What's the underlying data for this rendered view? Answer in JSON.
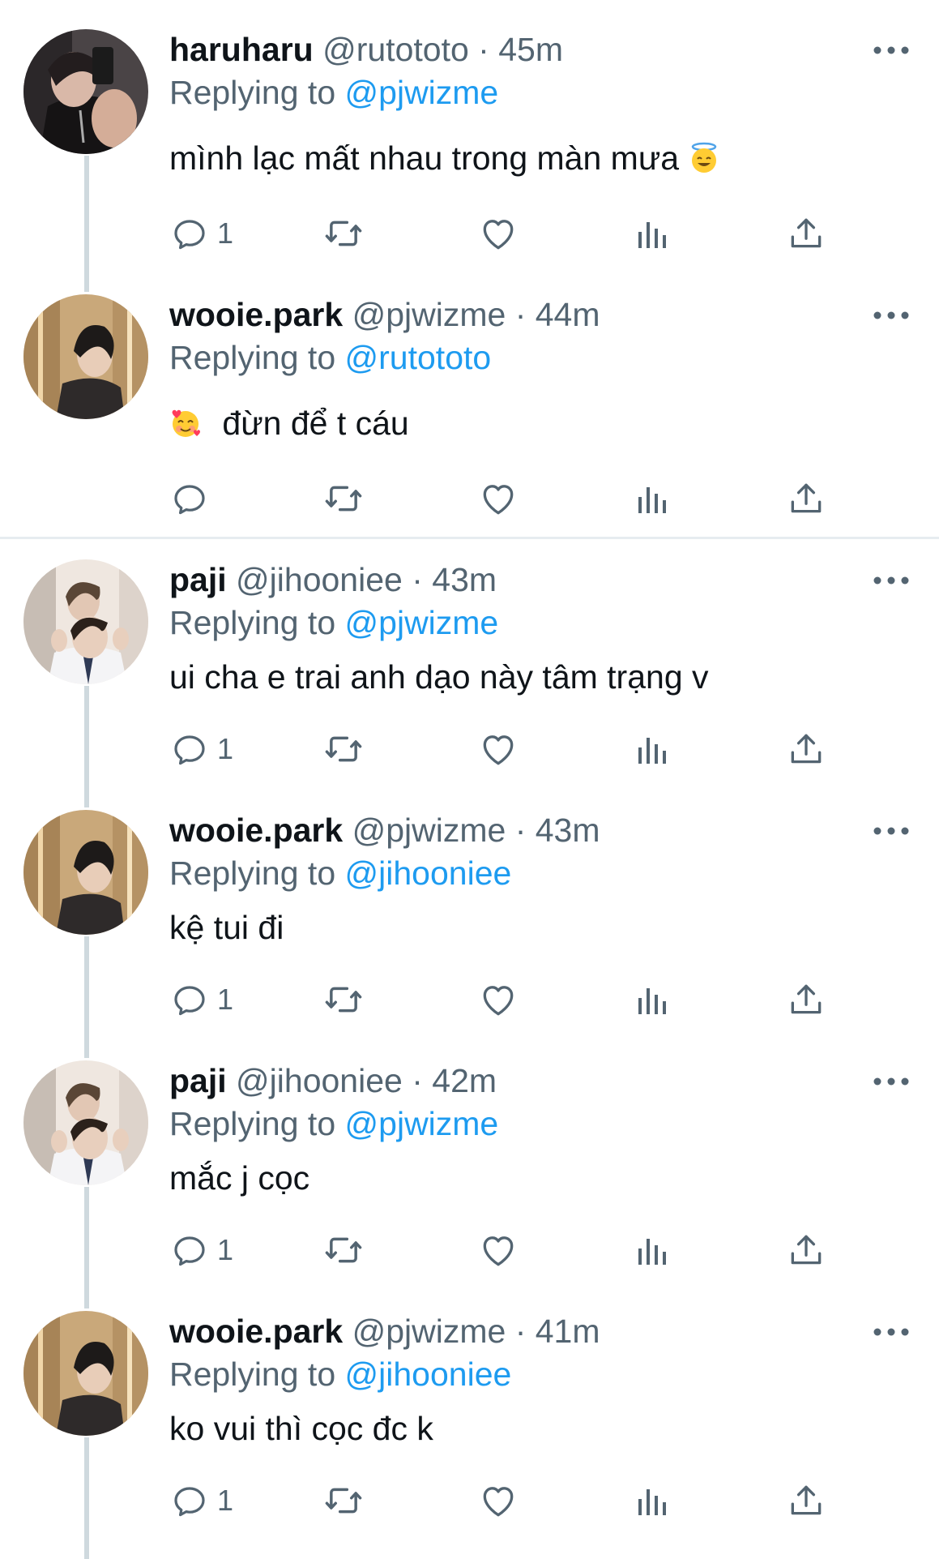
{
  "colors": {
    "accent": "#1d9bf0",
    "secondary_text": "#536471",
    "thread_line": "#cfd9de"
  },
  "icons": {
    "reply": "reply-icon",
    "retweet": "retweet-icon",
    "like": "heart-icon",
    "views": "views-icon",
    "share": "share-icon",
    "more": "more-icon"
  },
  "tweets": [
    {
      "name": "haruharu",
      "handle": "@rutototo",
      "time": "· 45m",
      "replying_prefix": "Replying to",
      "replying_to": "@pjwizme",
      "text": "mình lạc mất nhau trong màn mưa",
      "emoji": "😇",
      "reply_count": "1"
    },
    {
      "name": "wooie.park",
      "handle": "@pjwizme",
      "time": "· 44m",
      "replying_prefix": "Replying to",
      "replying_to": "@rutototo",
      "text": "đừn để t cáu",
      "emoji": "🥰",
      "reply_count": ""
    },
    {
      "name": "paji",
      "handle": "@jihooniee",
      "time": "· 43m",
      "replying_prefix": "Replying to",
      "replying_to": "@pjwizme",
      "text": "ui cha e trai anh dạo này tâm trạng v",
      "reply_count": "1"
    },
    {
      "name": "wooie.park",
      "handle": "@pjwizme",
      "time": "· 43m",
      "replying_prefix": "Replying to",
      "replying_to": "@jihooniee",
      "text": "kệ tui đi",
      "reply_count": "1"
    },
    {
      "name": "paji",
      "handle": "@jihooniee",
      "time": "· 42m",
      "replying_prefix": "Replying to",
      "replying_to": "@pjwizme",
      "text": "mắc j cọc",
      "reply_count": "1"
    },
    {
      "name": "wooie.park",
      "handle": "@pjwizme",
      "time": "· 41m",
      "replying_prefix": "Replying to",
      "replying_to": "@jihooniee",
      "text": "ko vui thì cọc đc k",
      "reply_count": "1"
    }
  ]
}
